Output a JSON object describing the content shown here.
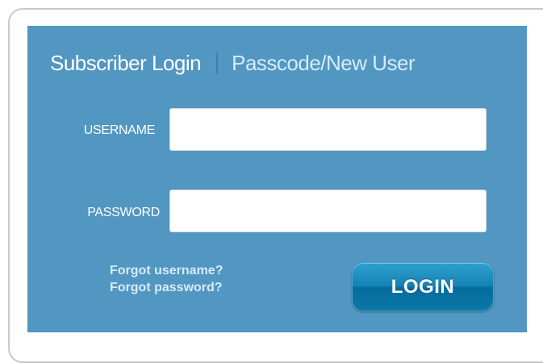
{
  "header": {
    "active_tab": "Subscriber Login",
    "inactive_tab": "Passcode/New User"
  },
  "form": {
    "username_label": "USERNAME",
    "username_value": "",
    "password_label": "PASSWORD",
    "password_value": ""
  },
  "links": {
    "forgot_username": "Forgot username?",
    "forgot_password": "Forgot password?"
  },
  "actions": {
    "login_label": "LOGIN"
  },
  "colors": {
    "panel_background": "#5296c2",
    "button_primary": "#1382b4",
    "inactive_tab_text": "#d3ecf9"
  }
}
